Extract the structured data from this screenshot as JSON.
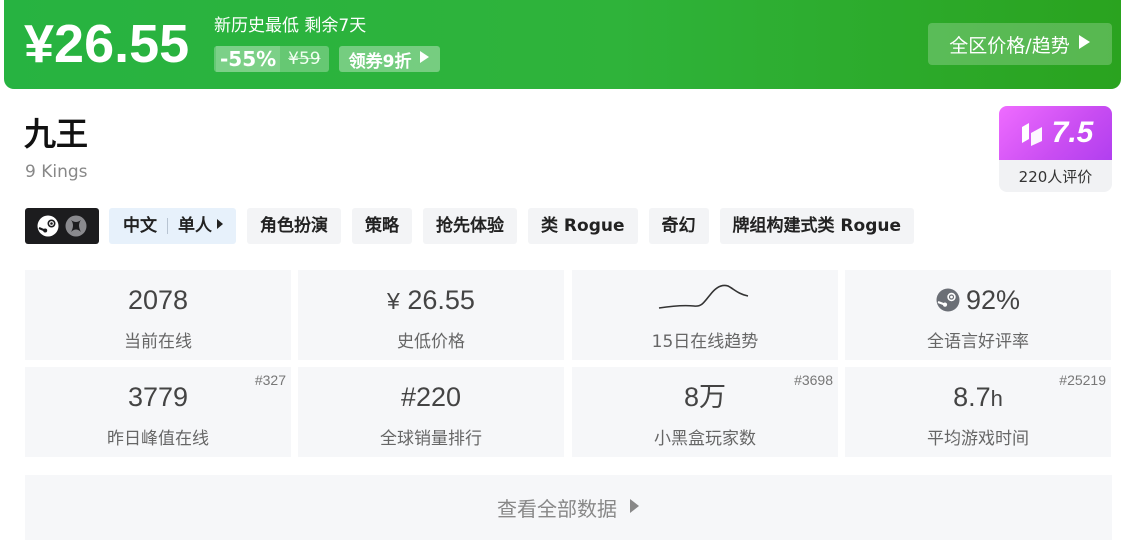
{
  "banner": {
    "currency": "¥",
    "price": "26.55",
    "note": "新历史最低 剩余7天",
    "discount": "-55%",
    "original_price": "¥59",
    "coupon_label": "领券9折",
    "trend_button": "全区价格/趋势",
    "color": "#2db33d"
  },
  "game": {
    "title": "九王",
    "subtitle": "9 Kings"
  },
  "score": {
    "value": "7.5",
    "reviews": "220人评价",
    "color": "#c94df2"
  },
  "platforms": [
    "steam-icon",
    "xbox-icon"
  ],
  "language_tag": {
    "language": "中文",
    "mode": "单人"
  },
  "tags": [
    "角色扮演",
    "策略",
    "抢先体验",
    "类 Rogue",
    "奇幻",
    "牌组构建式类 Rogue"
  ],
  "stats": [
    {
      "value": "2078",
      "label": "当前在线",
      "rank": ""
    },
    {
      "currency": "¥",
      "value": "26.55",
      "label": "史低价格",
      "rank": ""
    },
    {
      "value": "",
      "label": "15日在线趋势",
      "rank": ""
    },
    {
      "value": "92%",
      "label": "全语言好评率",
      "rank": ""
    },
    {
      "value": "3779",
      "label": "昨日峰值在线",
      "rank": "#327"
    },
    {
      "value": "#220",
      "label": "全球销量排行",
      "rank": ""
    },
    {
      "value": "8万",
      "label": "小黑盒玩家数",
      "rank": "#3698"
    },
    {
      "value": "8.7",
      "unit": "h",
      "label": "平均游戏时间",
      "rank": "#25219"
    }
  ],
  "view_all": "查看全部数据"
}
